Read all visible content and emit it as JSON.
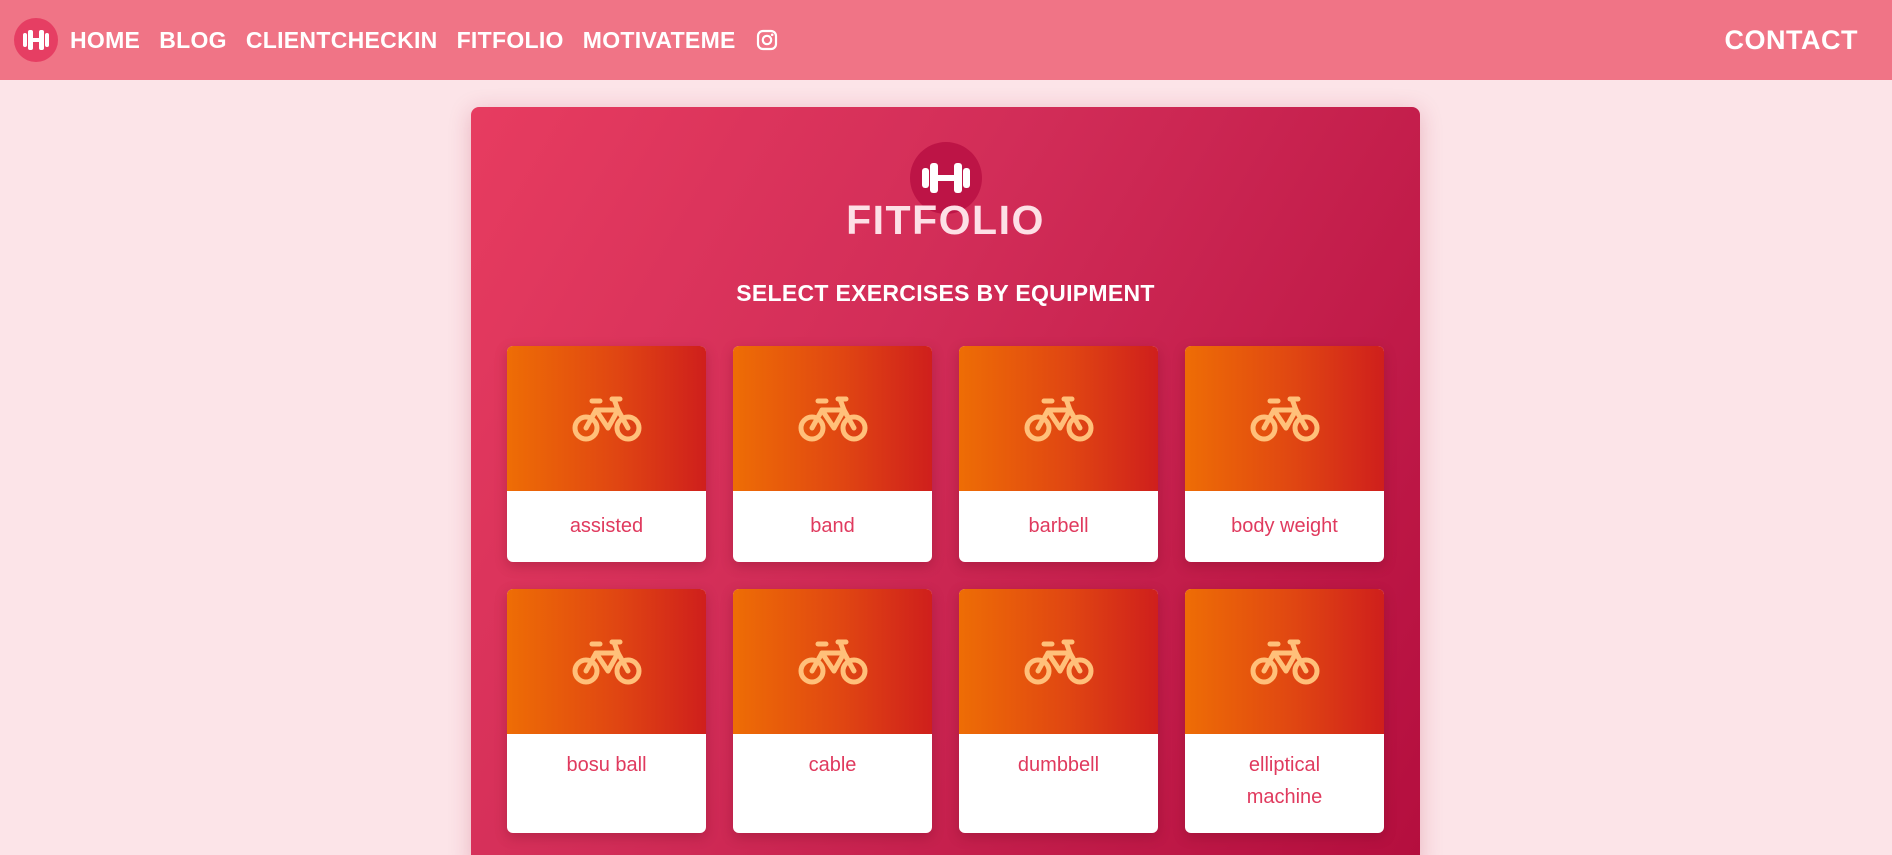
{
  "nav": {
    "links": [
      {
        "label": "HOME"
      },
      {
        "label": "BLOG"
      },
      {
        "label": "CLIENTCHECKIN"
      },
      {
        "label": "FITFOLIO"
      },
      {
        "label": "MOTIVATEME"
      }
    ],
    "instagram_icon": "instagram-icon",
    "logo_icon": "dumbbell-icon",
    "contact": "CONTACT"
  },
  "hero": {
    "logo_icon": "dumbbell-icon",
    "title": "FITFOLIO",
    "subtitle": "SELECT EXERCISES BY EQUIPMENT"
  },
  "equipment": [
    {
      "label": "assisted",
      "icon": "bicycle-icon"
    },
    {
      "label": "band",
      "icon": "bicycle-icon"
    },
    {
      "label": "barbell",
      "icon": "bicycle-icon"
    },
    {
      "label": "body weight",
      "icon": "bicycle-icon"
    },
    {
      "label": "bosu ball",
      "icon": "bicycle-icon"
    },
    {
      "label": "cable",
      "icon": "bicycle-icon"
    },
    {
      "label": "dumbbell",
      "icon": "bicycle-icon"
    },
    {
      "label": "elliptical machine",
      "icon": "bicycle-icon"
    }
  ],
  "colors": {
    "page_background": "#fce4e8",
    "navbar": "#f07486",
    "panel_start": "#e73c60",
    "panel_end": "#b40e3e",
    "card_gradient_start": "#ee6d05",
    "card_gradient_end": "#cf1f1c",
    "card_label": "#e03a5e",
    "icon": "#ffc07a"
  }
}
